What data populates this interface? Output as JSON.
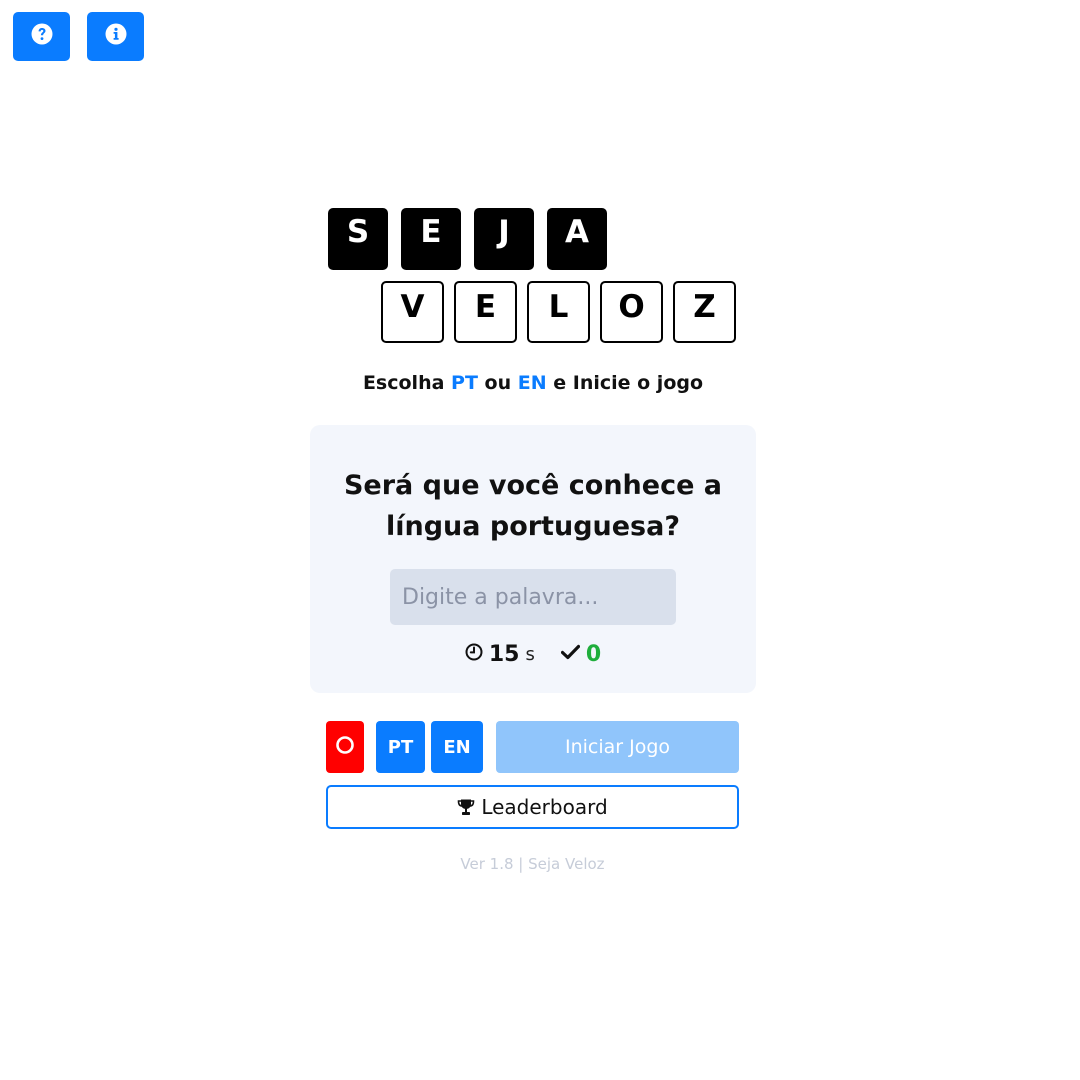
{
  "top_bar": {
    "help_icon": "question-circle-icon",
    "info_icon": "info-circle-icon"
  },
  "logo": {
    "row1": [
      "S",
      "E",
      "J",
      "A"
    ],
    "row2": [
      "V",
      "E",
      "L",
      "O",
      "Z"
    ]
  },
  "subtitle": {
    "part1": "Escolha ",
    "pt": "PT",
    "part2": " ou ",
    "en": "EN",
    "part3": " e Inicie o jogo"
  },
  "card": {
    "title_line1": "Será que você conhece a",
    "title_line2": "língua portuguesa?",
    "input_placeholder": "Digite a palavra...",
    "input_value": "",
    "timer_icon": "clock-icon",
    "timer_value": "15",
    "timer_unit": "s",
    "score_icon": "check-icon",
    "score_value": "0"
  },
  "controls": {
    "record_icon": "circle-icon",
    "pt_label": "PT",
    "en_label": "EN",
    "start_label": "Iniciar Jogo",
    "leaderboard_icon": "trophy-icon",
    "leaderboard_label": "Leaderboard"
  },
  "footer": {
    "text": "Ver 1.8 | Seja Veloz"
  },
  "colors": {
    "primary": "#0a7cff",
    "start_disabled": "#90c5fb",
    "record": "#ff0000",
    "score": "#1fae3c",
    "card_bg": "#f3f6fc"
  }
}
